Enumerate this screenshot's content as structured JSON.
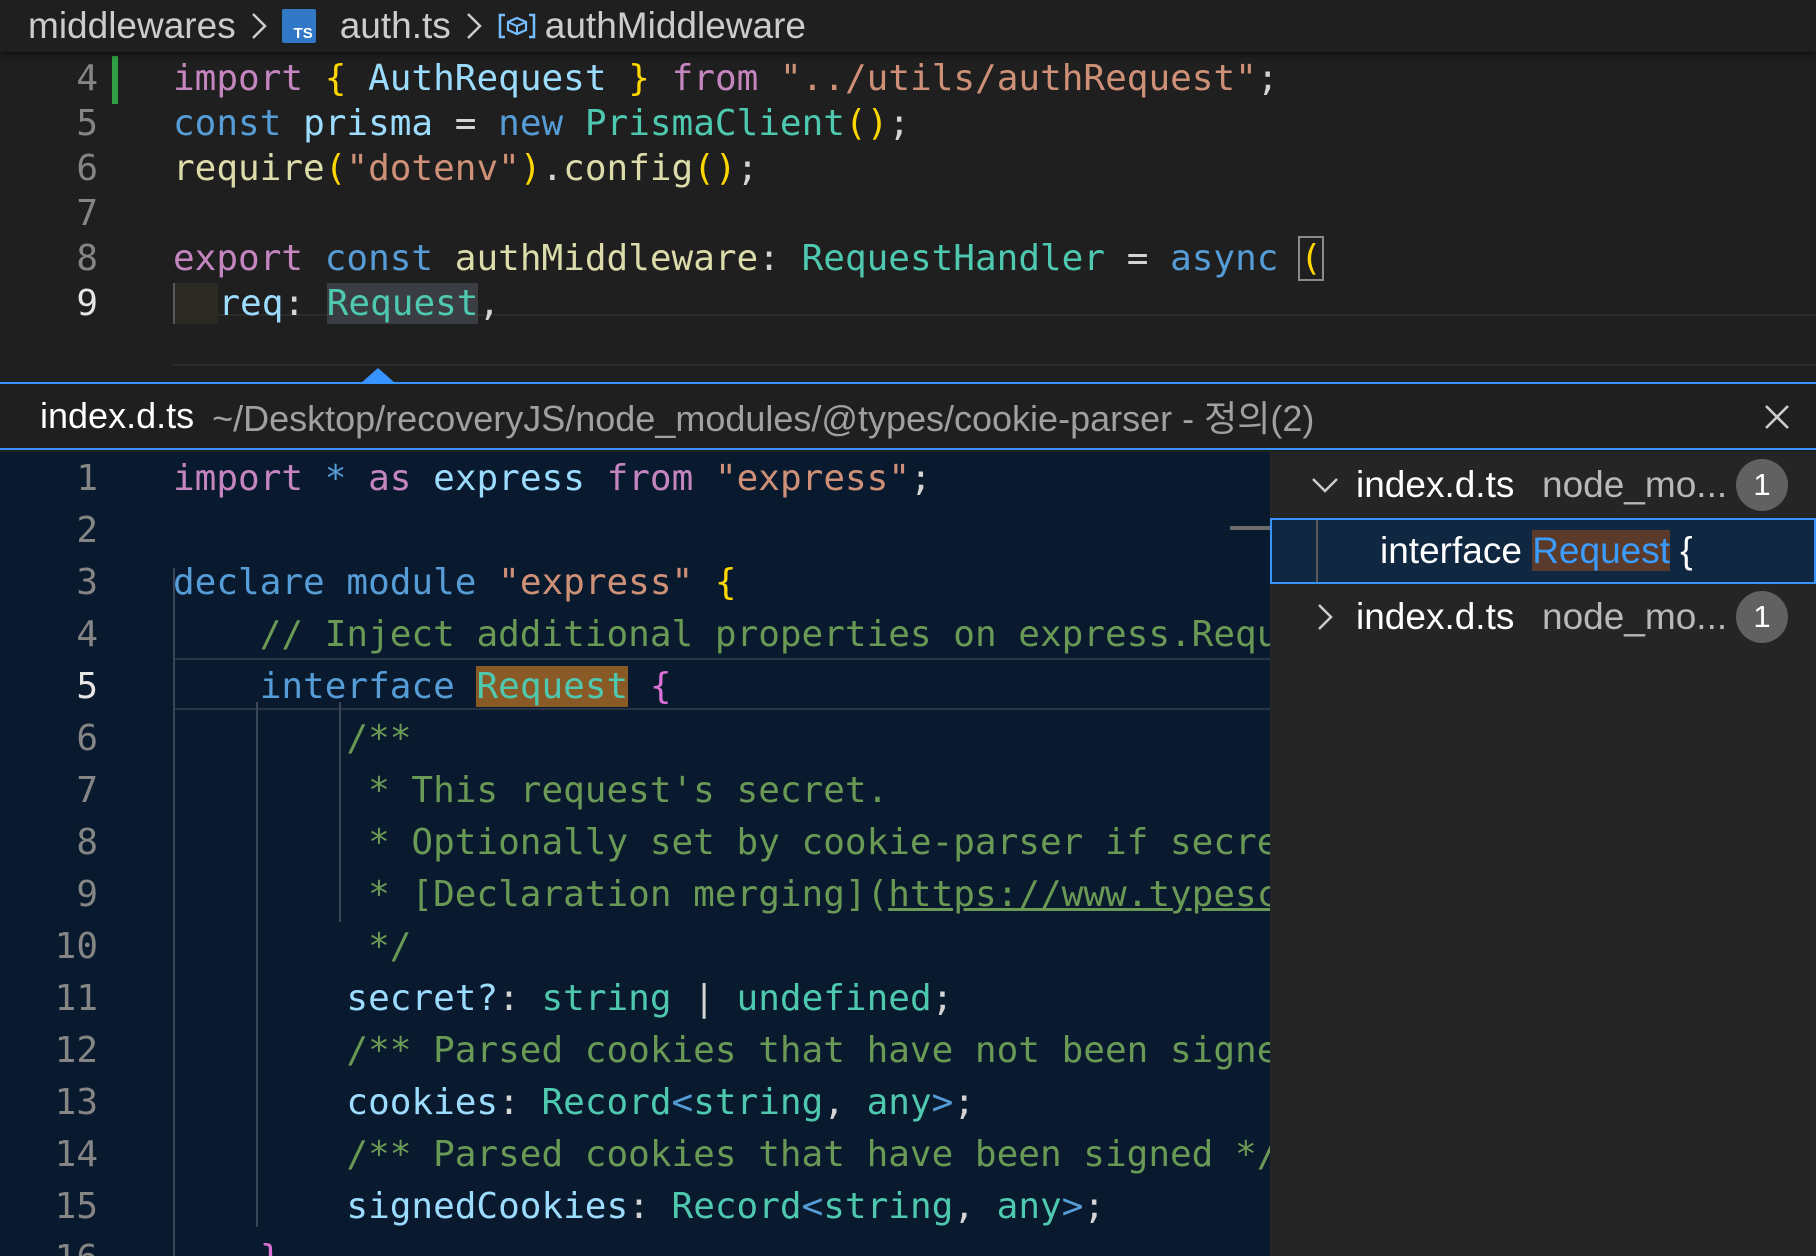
{
  "breadcrumb": {
    "folder": "middlewares",
    "file_icon": "typescript-file-icon",
    "file_badge": "TS",
    "file": "auth.ts",
    "symbol_icon": "symbol-variable-icon",
    "symbol": "authMiddleware"
  },
  "top_editor": {
    "lines": [
      {
        "n": "4",
        "tokens": [
          "import",
          " ",
          "{",
          " ",
          "AuthRequest",
          " ",
          "}",
          " ",
          "from",
          " ",
          "\"../utils/authRequest\"",
          ";"
        ]
      },
      {
        "n": "5",
        "tokens": [
          "const",
          " ",
          "prisma",
          " = ",
          "new",
          " ",
          "PrismaClient",
          "(",
          ")",
          ";"
        ]
      },
      {
        "n": "6",
        "tokens": [
          "require",
          "(",
          "\"dotenv\"",
          ")",
          ".",
          "config",
          "(",
          ")",
          ";"
        ]
      },
      {
        "n": "7",
        "tokens": []
      },
      {
        "n": "8",
        "tokens": [
          "export",
          " ",
          "const",
          " ",
          "authMiddleware",
          ": ",
          "RequestHandler",
          " = ",
          "async",
          " ",
          "("
        ]
      },
      {
        "n": "9",
        "tokens": [
          "  ",
          "req",
          ": ",
          "Request",
          ","
        ]
      }
    ]
  },
  "peek": {
    "file": "index.d.ts",
    "path": "~/Desktop/recoveryJS/node_modules/@types/cookie-parser - 정의(2)",
    "close_icon": "close-icon",
    "lines": [
      {
        "n": "1",
        "tokens": [
          "import",
          " ",
          "*",
          " ",
          "as",
          " ",
          "express",
          " ",
          "from",
          " ",
          "\"express\"",
          ";"
        ]
      },
      {
        "n": "2",
        "tokens": []
      },
      {
        "n": "3",
        "tokens": [
          "declare",
          " ",
          "module",
          " ",
          "\"express\"",
          " ",
          "{"
        ]
      },
      {
        "n": "4",
        "tokens": [
          "    ",
          "// Inject additional properties on express.Reques"
        ]
      },
      {
        "n": "5",
        "tokens": [
          "    ",
          "interface",
          " ",
          "Request",
          " ",
          "{"
        ]
      },
      {
        "n": "6",
        "tokens": [
          "        ",
          "/**"
        ]
      },
      {
        "n": "7",
        "tokens": [
          "        ",
          " * This request's secret."
        ]
      },
      {
        "n": "8",
        "tokens": [
          "        ",
          " * Optionally set by cookie-parser if secret("
        ]
      },
      {
        "n": "9",
        "tokens": [
          "        ",
          " * [Declaration merging](",
          "https://www.typescri"
        ]
      },
      {
        "n": "10",
        "tokens": [
          "        ",
          " */"
        ]
      },
      {
        "n": "11",
        "tokens": [
          "        ",
          "secret?",
          ": ",
          "string",
          " | ",
          "undefined",
          ";"
        ]
      },
      {
        "n": "12",
        "tokens": [
          "        ",
          "/** Parsed cookies that have not been signed"
        ]
      },
      {
        "n": "13",
        "tokens": [
          "        ",
          "cookies",
          ": ",
          "Record",
          "<",
          "string",
          ", ",
          "any",
          ">",
          ";"
        ]
      },
      {
        "n": "14",
        "tokens": [
          "        ",
          "/** Parsed cookies that have been signed */"
        ]
      },
      {
        "n": "15",
        "tokens": [
          "        ",
          "signedCookies",
          ": ",
          "Record",
          "<",
          "string",
          ", ",
          "any",
          ">",
          ";"
        ]
      },
      {
        "n": "16",
        "tokens": [
          "    ",
          "}"
        ]
      }
    ]
  },
  "references": {
    "groups": [
      {
        "file": "index.d.ts",
        "desc": "node_mo...",
        "count": "1",
        "expanded": true,
        "child": {
          "pre": "interface ",
          "match": "Request",
          "post": " {"
        }
      },
      {
        "file": "index.d.ts",
        "desc": "node_mo...",
        "count": "1",
        "expanded": false
      }
    ]
  }
}
